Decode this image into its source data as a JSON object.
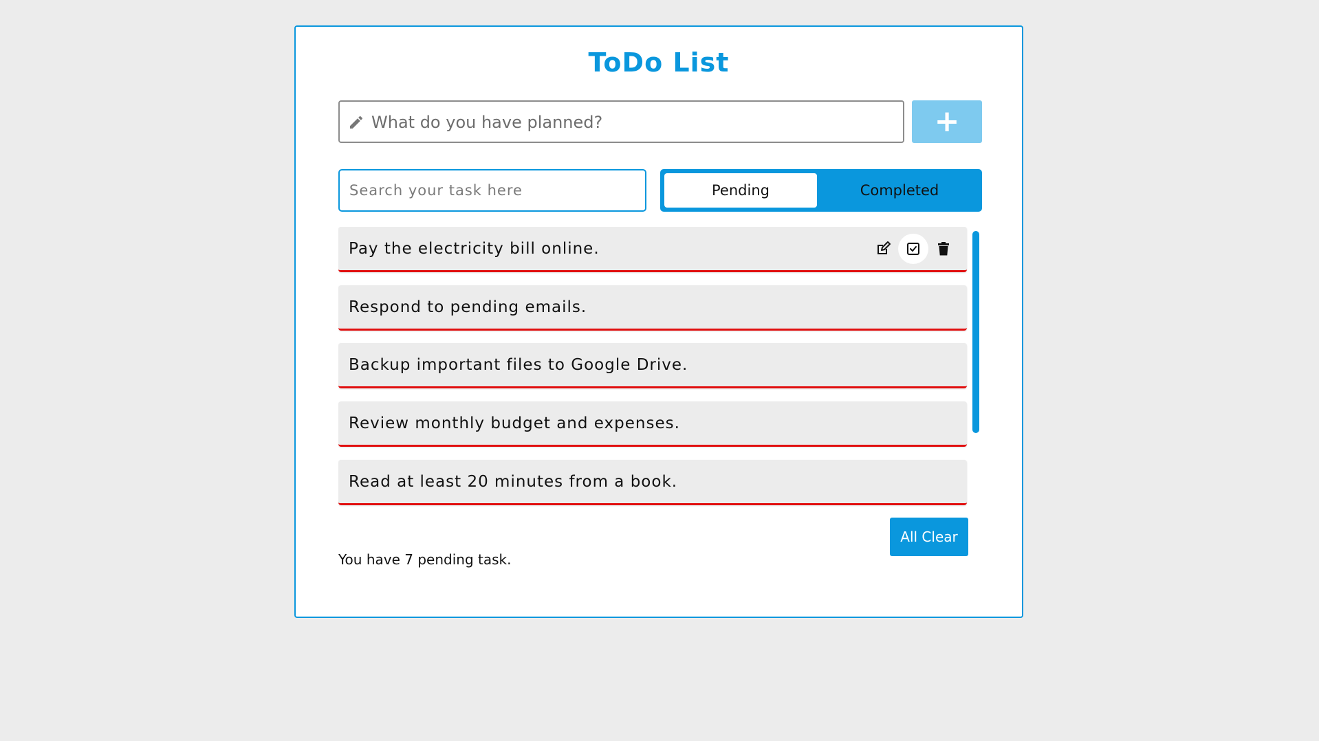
{
  "app": {
    "title": "ToDo List"
  },
  "new_task": {
    "placeholder": "What do you have planned?",
    "value": "",
    "add_button_label": "+",
    "icon": "pencil-icon"
  },
  "search": {
    "placeholder": "Search your task here",
    "value": ""
  },
  "filters": {
    "pending_label": "Pending",
    "completed_label": "Completed",
    "selected": "Pending"
  },
  "tasks": [
    {
      "text": "Pay the electricity bill online."
    },
    {
      "text": "Respond to pending emails."
    },
    {
      "text": "Backup important files to Google Drive."
    },
    {
      "text": "Review monthly budget and expenses."
    },
    {
      "text": "Read at least 20 minutes from a book."
    }
  ],
  "task_actions": {
    "edit_icon": "edit-icon",
    "complete_icon": "checkbox-icon",
    "delete_icon": "trash-icon"
  },
  "footer": {
    "pending_text": "You have 7 pending task.",
    "clear_button_label": "All Clear"
  },
  "colors": {
    "accent": "#0a97dd",
    "add_button": "#7ecaef",
    "pending_underline": "#e10f0f",
    "background": "#ececec"
  }
}
